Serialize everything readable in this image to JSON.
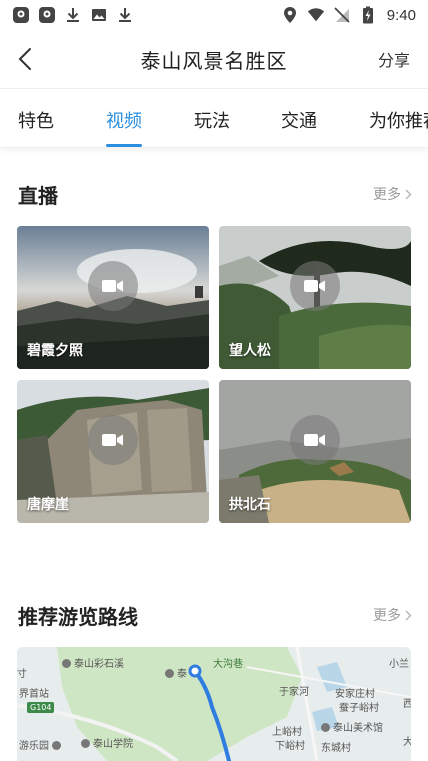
{
  "status_bar": {
    "time": "9:40",
    "left_icons": [
      "map-pin-notification-icon",
      "map-pin-notification-icon",
      "download-icon",
      "image-icon",
      "download-icon"
    ],
    "right_icons": [
      "location-icon",
      "wifi-icon",
      "no-sim-icon",
      "battery-charging-icon"
    ]
  },
  "header": {
    "title": "泰山风景名胜区",
    "share_label": "分享"
  },
  "tabs": [
    {
      "label": "特色",
      "active": false
    },
    {
      "label": "视频",
      "active": true
    },
    {
      "label": "玩法",
      "active": false
    },
    {
      "label": "交通",
      "active": false
    },
    {
      "label": "为你推荐",
      "active": false
    }
  ],
  "live_section": {
    "title": "直播",
    "more_label": "更多",
    "videos": [
      {
        "label": "碧霞夕照"
      },
      {
        "label": "望人松"
      },
      {
        "label": "唐摩崖"
      },
      {
        "label": "拱北石"
      }
    ]
  },
  "route_section": {
    "title": "推荐游览路线",
    "more_label": "更多",
    "map_labels": {
      "l1": "泰山彩石溪",
      "l2": "大沟巷",
      "l3": "小兰",
      "l4": "界首站",
      "l5": "于家河",
      "l6": "安家庄村",
      "l7": "西",
      "l8": "蚕子峪村",
      "l9": "上峪村",
      "l10": "泰山美术馆",
      "l11": "大",
      "l12": "游乐园",
      "l13": "泰山学院",
      "l14": "下峪村",
      "l15": "东城村",
      "l16": "寸",
      "l17": "泰",
      "road": "G104"
    }
  },
  "colors": {
    "accent": "#2a8fe0",
    "text_primary": "#222222",
    "text_secondary": "#9a9a9a",
    "route_line": "#2f7de0"
  }
}
